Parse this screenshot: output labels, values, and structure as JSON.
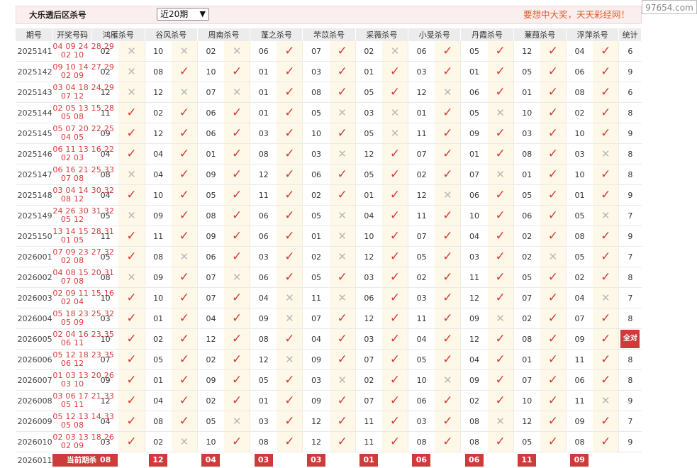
{
  "watermark": "97654.com",
  "header": {
    "title": "大乐透后区杀号",
    "period_select": "近20期",
    "slogan": "要想中大奖，天天彩经网！"
  },
  "columns": {
    "issue": "期号",
    "draw": "开奖号码",
    "stat": "统计",
    "experts": [
      "鸿雁杀号",
      "谷风杀号",
      "周南杀号",
      "蓬之杀号",
      "芣苡杀号",
      "采薇杀号",
      "小旻杀号",
      "丹霞杀号",
      "蒹葭杀号",
      "浮萍杀号"
    ]
  },
  "rows": [
    {
      "issue": "2025141",
      "front": "04 09 24 28 29",
      "back": "02 10",
      "picks": [
        "02",
        "10",
        "02",
        "06",
        "07",
        "02",
        "06",
        "05",
        "12",
        "04"
      ],
      "hits": [
        0,
        0,
        0,
        1,
        1,
        0,
        1,
        1,
        1,
        1
      ],
      "stat": "6"
    },
    {
      "issue": "2025142",
      "front": "09 10 14 27 29",
      "back": "02 09",
      "picks": [
        "02",
        "08",
        "10",
        "01",
        "03",
        "01",
        "03",
        "01",
        "05",
        "06"
      ],
      "hits": [
        0,
        1,
        1,
        1,
        1,
        1,
        1,
        1,
        1,
        1
      ],
      "stat": "9"
    },
    {
      "issue": "2025143",
      "front": "03 04 18 24 29",
      "back": "07 12",
      "picks": [
        "12",
        "12",
        "07",
        "01",
        "08",
        "05",
        "12",
        "06",
        "01",
        "08"
      ],
      "hits": [
        0,
        0,
        0,
        1,
        1,
        1,
        0,
        1,
        1,
        1
      ],
      "stat": "6"
    },
    {
      "issue": "2025144",
      "front": "02 05 13 15 28",
      "back": "05 08",
      "picks": [
        "11",
        "02",
        "06",
        "01",
        "05",
        "03",
        "01",
        "05",
        "10",
        "02"
      ],
      "hits": [
        1,
        1,
        1,
        1,
        0,
        0,
        1,
        0,
        1,
        1
      ],
      "stat": "8"
    },
    {
      "issue": "2025145",
      "front": "05 07 20 22 25",
      "back": "04 05",
      "picks": [
        "09",
        "12",
        "06",
        "03",
        "10",
        "05",
        "11",
        "09",
        "03",
        "10"
      ],
      "hits": [
        1,
        1,
        1,
        1,
        1,
        0,
        1,
        1,
        1,
        1
      ],
      "stat": "9"
    },
    {
      "issue": "2025146",
      "front": "06 11 13 16 22",
      "back": "02 03",
      "picks": [
        "04",
        "04",
        "01",
        "08",
        "03",
        "12",
        "07",
        "01",
        "08",
        "03"
      ],
      "hits": [
        1,
        1,
        1,
        1,
        0,
        1,
        1,
        1,
        1,
        0
      ],
      "stat": "8"
    },
    {
      "issue": "2025147",
      "front": "06 16 21 25 33",
      "back": "07 08",
      "picks": [
        "08",
        "04",
        "09",
        "12",
        "06",
        "05",
        "02",
        "07",
        "01",
        "10"
      ],
      "hits": [
        0,
        1,
        1,
        1,
        1,
        1,
        1,
        0,
        1,
        1
      ],
      "stat": "8"
    },
    {
      "issue": "2025148",
      "front": "03 04 14 30 32",
      "back": "08 12",
      "picks": [
        "04",
        "10",
        "05",
        "11",
        "02",
        "01",
        "12",
        "06",
        "05",
        "01"
      ],
      "hits": [
        1,
        1,
        1,
        1,
        1,
        1,
        0,
        1,
        1,
        1
      ],
      "stat": "9"
    },
    {
      "issue": "2025149",
      "front": "24 26 30 31 32",
      "back": "05 12",
      "picks": [
        "05",
        "09",
        "08",
        "06",
        "05",
        "04",
        "11",
        "10",
        "06",
        "05"
      ],
      "hits": [
        0,
        1,
        1,
        1,
        0,
        1,
        1,
        1,
        1,
        0
      ],
      "stat": "7"
    },
    {
      "issue": "2025150",
      "front": "13 14 15 28 31",
      "back": "01 05",
      "picks": [
        "11",
        "11",
        "09",
        "06",
        "01",
        "10",
        "07",
        "04",
        "02",
        "08"
      ],
      "hits": [
        1,
        1,
        1,
        1,
        0,
        1,
        1,
        1,
        1,
        1
      ],
      "stat": "9"
    },
    {
      "issue": "2026001",
      "front": "07 09 23 27 32",
      "back": "02 08",
      "picks": [
        "05",
        "08",
        "06",
        "03",
        "02",
        "12",
        "05",
        "03",
        "02",
        "05"
      ],
      "hits": [
        1,
        0,
        1,
        1,
        0,
        1,
        1,
        1,
        0,
        1
      ],
      "stat": "7"
    },
    {
      "issue": "2026002",
      "front": "04 08 15 20 31",
      "back": "07 08",
      "picks": [
        "08",
        "09",
        "07",
        "06",
        "05",
        "03",
        "02",
        "11",
        "05",
        "02"
      ],
      "hits": [
        0,
        1,
        0,
        1,
        1,
        1,
        1,
        1,
        1,
        1
      ],
      "stat": "8"
    },
    {
      "issue": "2026003",
      "front": "02 09 11 15 16",
      "back": "02 04",
      "picks": [
        "10",
        "10",
        "07",
        "04",
        "11",
        "06",
        "03",
        "12",
        "07",
        "04"
      ],
      "hits": [
        1,
        1,
        1,
        0,
        0,
        1,
        1,
        1,
        1,
        0
      ],
      "stat": "7"
    },
    {
      "issue": "2026004",
      "front": "05 18 23 25 32",
      "back": "05 09",
      "picks": [
        "03",
        "01",
        "04",
        "09",
        "07",
        "12",
        "11",
        "09",
        "02",
        "07"
      ],
      "hits": [
        1,
        1,
        1,
        0,
        1,
        1,
        1,
        0,
        1,
        1
      ],
      "stat": "8"
    },
    {
      "issue": "2026005",
      "front": "02 04 16 23 35",
      "back": "06 11",
      "picks": [
        "10",
        "02",
        "12",
        "08",
        "04",
        "03",
        "04",
        "12",
        "08",
        "09"
      ],
      "hits": [
        1,
        1,
        1,
        1,
        1,
        1,
        1,
        1,
        1,
        1
      ],
      "stat": "全对"
    },
    {
      "issue": "2026006",
      "front": "05 12 18 23 35",
      "back": "06 12",
      "picks": [
        "07",
        "05",
        "02",
        "12",
        "09",
        "07",
        "05",
        "04",
        "01",
        "11"
      ],
      "hits": [
        1,
        1,
        1,
        0,
        1,
        1,
        1,
        1,
        1,
        1
      ],
      "stat": "8"
    },
    {
      "issue": "2026007",
      "front": "01 03 13 20 26",
      "back": "03 10",
      "picks": [
        "09",
        "01",
        "09",
        "05",
        "03",
        "02",
        "10",
        "09",
        "07",
        "06"
      ],
      "hits": [
        1,
        1,
        1,
        1,
        0,
        1,
        0,
        1,
        1,
        1
      ],
      "stat": "8"
    },
    {
      "issue": "2026008",
      "front": "03 06 17 21 33",
      "back": "05 11",
      "picks": [
        "12",
        "04",
        "02",
        "01",
        "09",
        "07",
        "06",
        "02",
        "10",
        "11"
      ],
      "hits": [
        1,
        1,
        1,
        1,
        1,
        1,
        1,
        1,
        1,
        0
      ],
      "stat": "9"
    },
    {
      "issue": "2026009",
      "front": "05 12 13 14 33",
      "back": "05 08",
      "picks": [
        "04",
        "08",
        "05",
        "03",
        "12",
        "11",
        "03",
        "08",
        "12",
        "09"
      ],
      "hits": [
        1,
        1,
        0,
        1,
        1,
        1,
        1,
        0,
        1,
        1
      ],
      "stat": "7"
    },
    {
      "issue": "2026010",
      "front": "02 03 13 18 26",
      "back": "02 09",
      "picks": [
        "03",
        "02",
        "10",
        "08",
        "12",
        "11",
        "08",
        "08",
        "05",
        "08"
      ],
      "hits": [
        1,
        0,
        1,
        1,
        1,
        1,
        1,
        1,
        1,
        1
      ],
      "stat": "9"
    }
  ],
  "current": {
    "issue": "2026011",
    "label": "当前期杀号",
    "picks": [
      "08",
      "12",
      "04",
      "03",
      "03",
      "01",
      "06",
      "06",
      "11",
      "09"
    ]
  },
  "marks": {
    "hit": "✓",
    "miss": "✕"
  },
  "colors": {
    "hit": "#d53a3a",
    "miss": "#b8b8b8",
    "accent": "#cf3b3b",
    "mark_bg": "#fdf8e8"
  }
}
